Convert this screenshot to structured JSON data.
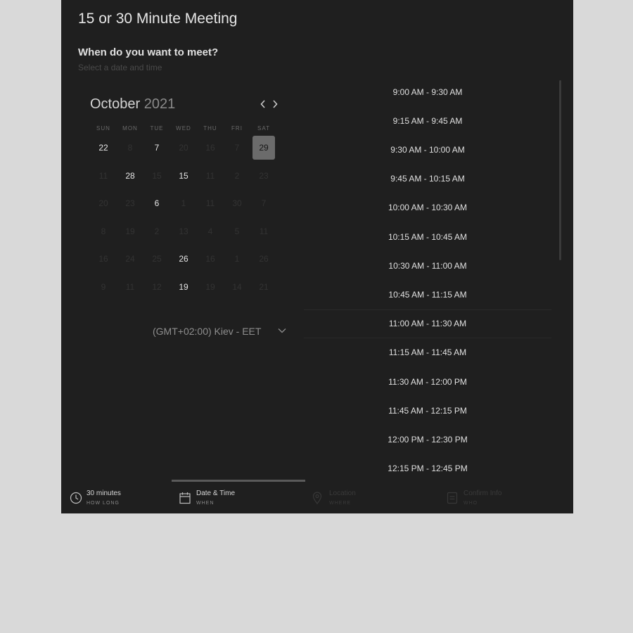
{
  "meeting": {
    "title": "15 or 30 Minute Meeting",
    "question": "When do you want to meet?",
    "subtitle": "Select a date and time"
  },
  "calendar": {
    "month": "October",
    "year": "2021",
    "weekdays": [
      "SUN",
      "MON",
      "TUE",
      "WED",
      "THU",
      "FRI",
      "SAT"
    ],
    "weeks": [
      [
        {
          "d": "22",
          "s": "a"
        },
        {
          "d": "8",
          "s": "u"
        },
        {
          "d": "7",
          "s": "a"
        },
        {
          "d": "20",
          "s": "u"
        },
        {
          "d": "16",
          "s": "u"
        },
        {
          "d": "7",
          "s": "u"
        },
        {
          "d": "29",
          "s": "s"
        }
      ],
      [
        {
          "d": "11",
          "s": "u"
        },
        {
          "d": "28",
          "s": "a"
        },
        {
          "d": "15",
          "s": "u"
        },
        {
          "d": "15",
          "s": "a"
        },
        {
          "d": "11",
          "s": "u"
        },
        {
          "d": "2",
          "s": "u"
        },
        {
          "d": "23",
          "s": "u"
        }
      ],
      [
        {
          "d": "20",
          "s": "u"
        },
        {
          "d": "23",
          "s": "u"
        },
        {
          "d": "6",
          "s": "a"
        },
        {
          "d": "1",
          "s": "u"
        },
        {
          "d": "11",
          "s": "u"
        },
        {
          "d": "30",
          "s": "u"
        },
        {
          "d": "7",
          "s": "u"
        }
      ],
      [
        {
          "d": "8",
          "s": "u"
        },
        {
          "d": "19",
          "s": "u"
        },
        {
          "d": "2",
          "s": "u"
        },
        {
          "d": "13",
          "s": "u"
        },
        {
          "d": "4",
          "s": "u"
        },
        {
          "d": "5",
          "s": "u"
        },
        {
          "d": "11",
          "s": "u"
        }
      ],
      [
        {
          "d": "16",
          "s": "u"
        },
        {
          "d": "24",
          "s": "u"
        },
        {
          "d": "25",
          "s": "u"
        },
        {
          "d": "26",
          "s": "a"
        },
        {
          "d": "16",
          "s": "u"
        },
        {
          "d": "1",
          "s": "u"
        },
        {
          "d": "26",
          "s": "u"
        }
      ],
      [
        {
          "d": "9",
          "s": "u"
        },
        {
          "d": "11",
          "s": "u"
        },
        {
          "d": "12",
          "s": "u"
        },
        {
          "d": "19",
          "s": "a"
        },
        {
          "d": "19",
          "s": "u"
        },
        {
          "d": "14",
          "s": "u"
        },
        {
          "d": "21",
          "s": "u"
        }
      ]
    ]
  },
  "timezone": {
    "label": "(GMT+02:00) Kiev - EET"
  },
  "time_slots": [
    "9:00 AM - 9:30 AM",
    "9:15 AM - 9:45 AM",
    "9:30 AM - 10:00 AM",
    "9:45 AM - 10:15 AM",
    "10:00 AM - 10:30 AM",
    "10:15 AM - 10:45 AM",
    "10:30 AM - 11:00 AM",
    "10:45 AM - 11:15 AM",
    "11:00 AM - 11:30 AM",
    "11:15 AM - 11:45 AM",
    "11:30 AM - 12:00 PM",
    "11:45 AM - 12:15 PM",
    "12:00 PM - 12:30 PM",
    "12:15 PM - 12:45 PM"
  ],
  "highlighted_slot_index": 8,
  "selected_date": "29",
  "steps": [
    {
      "label": "30 minutes",
      "caption": "HOW LONG",
      "icon": "clock-icon",
      "state": "done"
    },
    {
      "label": "Date & Time",
      "caption": "WHEN",
      "icon": "calendar-icon",
      "state": "active"
    },
    {
      "label": "Location",
      "caption": "WHERE",
      "icon": "location-pin-icon",
      "state": "upcoming"
    },
    {
      "label": "Confirm Info",
      "caption": "WHO",
      "icon": "confirm-info-icon",
      "state": "upcoming"
    }
  ],
  "colors": {
    "page_background": "#d9d9d9",
    "panel_background": "#1f1f1f",
    "selected_day": "#6b6b6b",
    "text_primary": "#e6e6e6",
    "text_disabled": "#333333"
  }
}
